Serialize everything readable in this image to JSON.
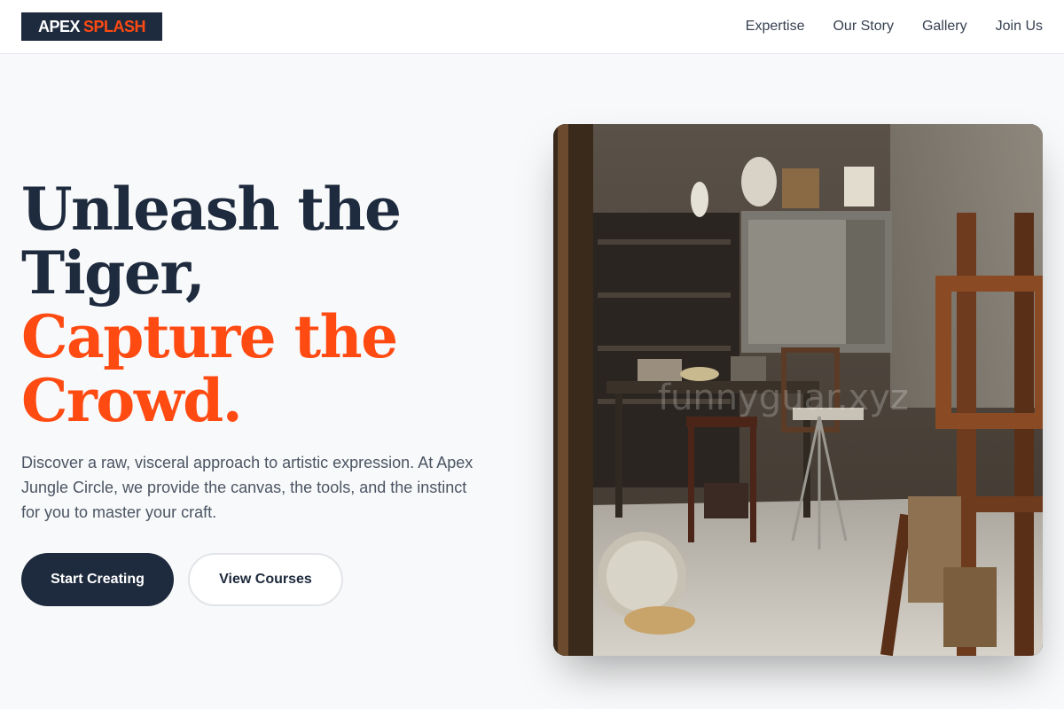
{
  "nav": {
    "logo_word1": "APEX",
    "logo_word2": "SPLASH",
    "links": [
      "Expertise",
      "Our Story",
      "Gallery",
      "Join Us"
    ]
  },
  "hero": {
    "headline_line1": "Unleash the",
    "headline_line2": "Tiger,",
    "headline_line3": "Capture the",
    "headline_line4": "Crowd.",
    "description": "Discover a raw, visceral approach to artistic expression. At Apex Jungle Circle, we provide the canvas, the tools, and the instinct for you to master your craft.",
    "primary_button": "Start Creating",
    "secondary_button": "View Courses",
    "image_watermark": "funnyguar.xyz"
  },
  "colors": {
    "brand_dark": "#1e2a3d",
    "accent": "#ff4a12",
    "background": "#f8f9fa"
  }
}
